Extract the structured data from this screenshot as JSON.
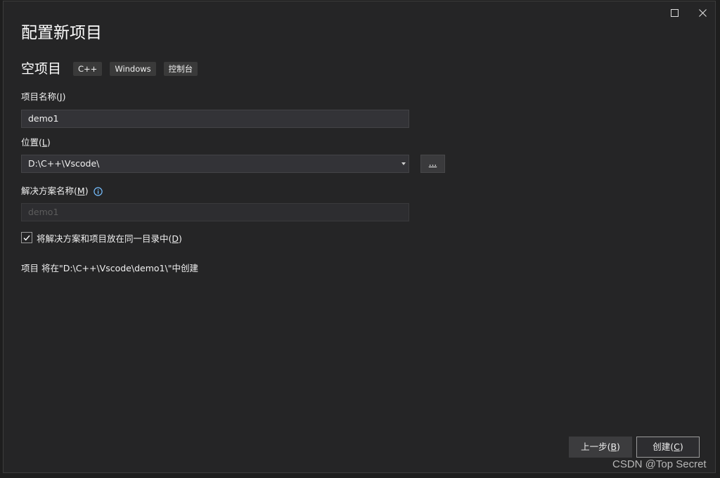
{
  "window": {
    "maximize_icon": "maximize-icon",
    "close_icon": "close-icon"
  },
  "page_title": "配置新项目",
  "template": {
    "name": "空项目",
    "tags": [
      "C++",
      "Windows",
      "控制台"
    ]
  },
  "project_name": {
    "label": "项目名称",
    "mnemonic": "J",
    "value": "demo1"
  },
  "location": {
    "label": "位置",
    "mnemonic": "L",
    "value": "D:\\C++\\Vscode\\",
    "browse_label": "..."
  },
  "solution_name": {
    "label": "解决方案名称",
    "mnemonic": "M",
    "placeholder": "demo1",
    "info_icon": "info-icon"
  },
  "same_dir": {
    "label": "将解决方案和项目放在同一目录中",
    "mnemonic": "D",
    "checked": true
  },
  "summary_text": "项目 将在\"D:\\C++\\Vscode\\demo1\\\"中创建",
  "footer": {
    "back_label": "上一步",
    "back_mnemonic": "B",
    "create_label": "创建",
    "create_mnemonic": "C"
  },
  "watermark": "CSDN @Top Secret",
  "colors": {
    "background": "#252526",
    "input_bg": "#333337",
    "accent_info": "#75beff"
  }
}
